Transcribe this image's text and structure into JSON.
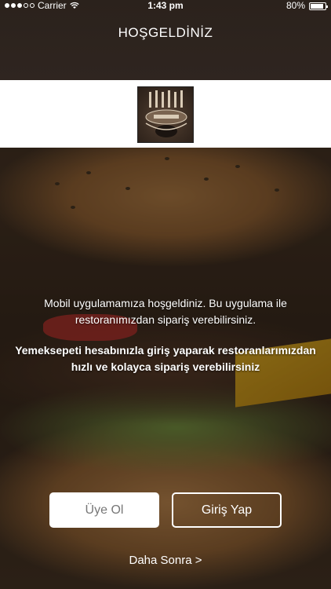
{
  "status_bar": {
    "carrier": "Carrier",
    "time": "1:43 pm",
    "battery": "80%",
    "battery_level": 0.8
  },
  "nav": {
    "title": "HOŞGELDİNİZ"
  },
  "logo": {
    "icon": "restaurant-logo"
  },
  "welcome": {
    "intro": "Mobil uygulamamıza  hoşgeldiniz. Bu uygulama ile restoranımızdan sipariş verebilirsiniz.",
    "highlight": "Yemeksepeti hesabınızla giriş yaparak restoranlarımızdan hızlı ve kolayca sipariş verebilirsiniz"
  },
  "actions": {
    "signup_label": "Üye Ol",
    "login_label": "Giriş Yap",
    "later_label": "Daha Sonra >"
  },
  "colors": {
    "header": "#2f2520",
    "button_text": "#777777"
  }
}
